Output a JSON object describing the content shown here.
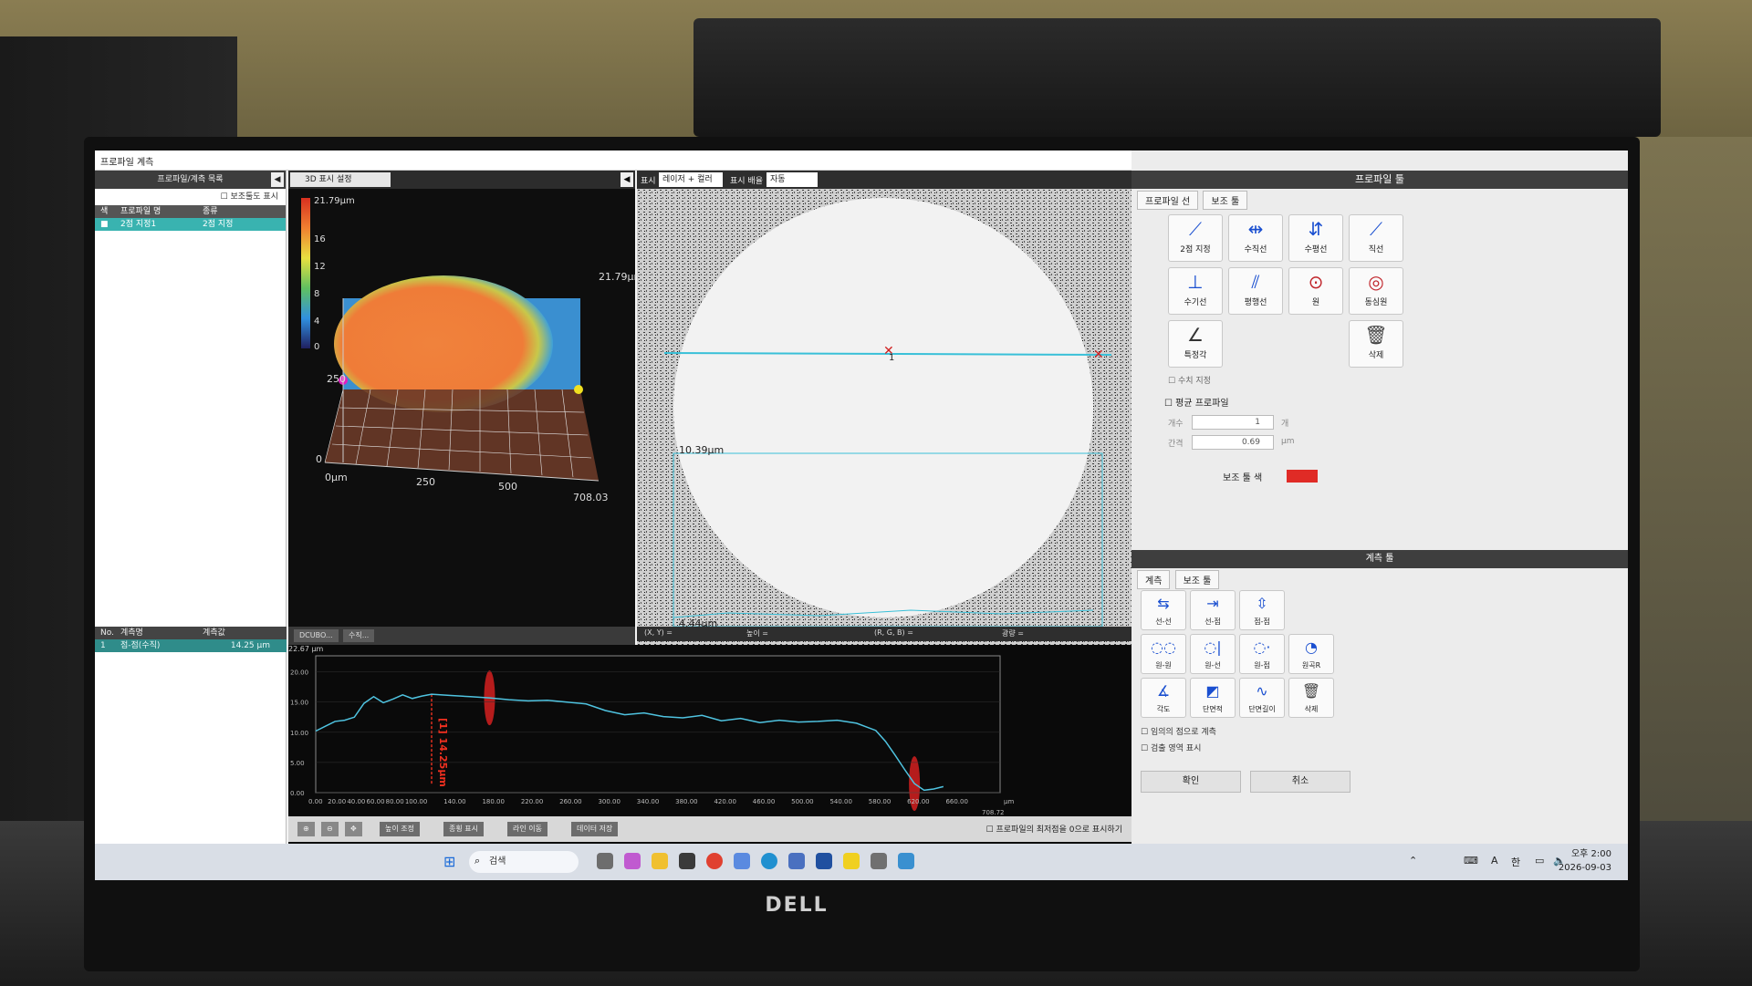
{
  "window": {
    "title": "프로파일 계측"
  },
  "left_list": {
    "header": "프로파일/계측 목록",
    "show_aux_checkbox": "보조툴도 표시",
    "columns": [
      "색",
      "프로파일 명",
      "종류"
    ],
    "rows": [
      {
        "color": "#39b3b0",
        "name": "2점 지정1",
        "type": "2점 지정"
      }
    ],
    "bottom_columns": [
      "No.",
      "계측명",
      "계측값"
    ],
    "bottom_rows": [
      {
        "no": "1",
        "name": "점-점(수직)",
        "value": "14.25 μm"
      }
    ]
  },
  "panel3d": {
    "tab_label": "3D 표시 설정",
    "colorbar": {
      "max": "21.79μm",
      "ticks": [
        "16",
        "12",
        "8",
        "4",
        "0"
      ],
      "min_label": "0.00μm"
    },
    "axis": {
      "z_top": "21.79μm",
      "y_labels": [
        "250",
        "0"
      ],
      "x_labels": [
        "0μm",
        "250",
        "500",
        "708.03"
      ]
    }
  },
  "mid_tabs": [
    "DCUBO...",
    "수직..."
  ],
  "image_view": {
    "display_label": "표시",
    "display_mode": "레이저 + 컬러",
    "zoom_label": "표시 배율",
    "zoom_value": "자동",
    "marker_label": "1",
    "overlay_top": "10.39μm",
    "overlay_bottom": "4.44μm",
    "status": {
      "xy": "(X, Y) =",
      "height": "높이 =",
      "rgb": "(R, G, B) =",
      "intensity": "광량 ="
    }
  },
  "profile_chart": {
    "y_top_label": "22.67 μm",
    "y_ticks": [
      "20.00",
      "15.00",
      "10.00",
      "5.00",
      "0.00"
    ],
    "x_ticks": [
      "0.00",
      "20.00",
      "40.00",
      "60.00",
      "80.00",
      "100.00",
      "140.00",
      "180.00",
      "220.00",
      "260.00",
      "300.00",
      "340.00",
      "380.00",
      "420.00",
      "460.00",
      "500.00",
      "540.00",
      "580.00",
      "620.00",
      "660.00"
    ],
    "x_end": "708.72",
    "x_unit": "μm",
    "measurement_label": "[1] 14.25μm",
    "bottom_buttons": [
      "높이 조정",
      "종횡 표시",
      "라인 이동",
      "데이터 저장"
    ],
    "zero_checkbox": "프로파일의 최저점을 0으로 표시하기"
  },
  "chart_data": {
    "type": "line",
    "x": [
      0,
      10,
      20,
      30,
      40,
      50,
      60,
      70,
      80,
      90,
      100,
      110,
      120,
      140,
      160,
      180,
      200,
      220,
      240,
      260,
      280,
      300,
      320,
      340,
      360,
      380,
      400,
      420,
      440,
      460,
      480,
      500,
      520,
      540,
      560,
      580,
      590,
      600,
      610,
      620,
      630,
      640,
      650
    ],
    "series": [
      {
        "values": [
          10.2,
          11.0,
          11.8,
          12.0,
          12.5,
          14.8,
          15.9,
          14.9,
          15.5,
          16.2,
          15.6,
          16.0,
          16.3,
          16.1,
          15.9,
          15.7,
          15.4,
          15.2,
          15.3,
          15.0,
          14.7,
          13.6,
          12.9,
          13.2,
          12.6,
          12.4,
          12.8,
          11.9,
          12.3,
          11.6,
          12.0,
          11.7,
          11.8,
          12.0,
          11.5,
          10.3,
          8.5,
          6.2,
          3.8,
          1.5,
          0.4,
          0.6,
          1.0
        ]
      }
    ],
    "xlim": [
      0,
      708.72
    ],
    "ylim": [
      0,
      22.67
    ],
    "xlabel": "",
    "ylabel": ""
  },
  "tool_panel": {
    "title": "프로파일 툴",
    "tabs": [
      "프로파일 선",
      "보조 툴"
    ],
    "tools": [
      {
        "label": "2점 지정",
        "icon": "two-point-icon"
      },
      {
        "label": "수직선",
        "icon": "vertical-line-icon"
      },
      {
        "label": "수평선",
        "icon": "horizontal-line-icon"
      },
      {
        "label": "직선",
        "icon": "line-icon"
      },
      {
        "label": "수기선",
        "icon": "freehand-line-icon"
      },
      {
        "label": "평행선",
        "icon": "parallel-line-icon"
      },
      {
        "label": "원",
        "icon": "circle-icon"
      },
      {
        "label": "동심원",
        "icon": "concentric-circle-icon"
      },
      {
        "label": "특정각",
        "icon": "angle-icon"
      },
      {
        "label": "삭제",
        "icon": "trash-icon"
      }
    ],
    "numeric_checkbox": "수치 지정",
    "avg_profile_checkbox": "평균 프로파일",
    "count_label": "개수",
    "count_value": "1",
    "count_unit": "개",
    "interval_label": "간격",
    "interval_value": "0.69",
    "interval_unit": "μm",
    "aux_color_label": "보조 툴 색",
    "aux_color": "#e02b26"
  },
  "measure_panel": {
    "title": "계측 툴",
    "tabs": [
      "계측",
      "보조 툴"
    ],
    "buttons": [
      {
        "label": "선-선",
        "icon": "line-line-icon"
      },
      {
        "label": "선-점",
        "icon": "line-point-icon"
      },
      {
        "label": "점-점",
        "icon": "point-point-icon"
      },
      {
        "label": "원-원",
        "icon": "circle-circle-icon"
      },
      {
        "label": "원-선",
        "icon": "circle-line-icon"
      },
      {
        "label": "원-점",
        "icon": "circle-point-icon"
      },
      {
        "label": "원곡R",
        "icon": "radius-icon"
      },
      {
        "label": "각도",
        "icon": "angle-measure-icon"
      },
      {
        "label": "단면적",
        "icon": "cross-section-area-icon"
      },
      {
        "label": "단면길이",
        "icon": "cross-section-length-icon"
      },
      {
        "label": "삭제",
        "icon": "trash-icon"
      }
    ],
    "arbitrary_point_checkbox": "임의의 점으로 계측",
    "show_area_checkbox": "검출 영역 표시",
    "ok_button": "확인",
    "cancel_button": "취소"
  },
  "taskbar": {
    "search": "검색",
    "time": "오후 2:00",
    "date": "2026-09-03",
    "ime_a": "A",
    "ime_han": "한"
  },
  "monitor_brand": "DELL"
}
